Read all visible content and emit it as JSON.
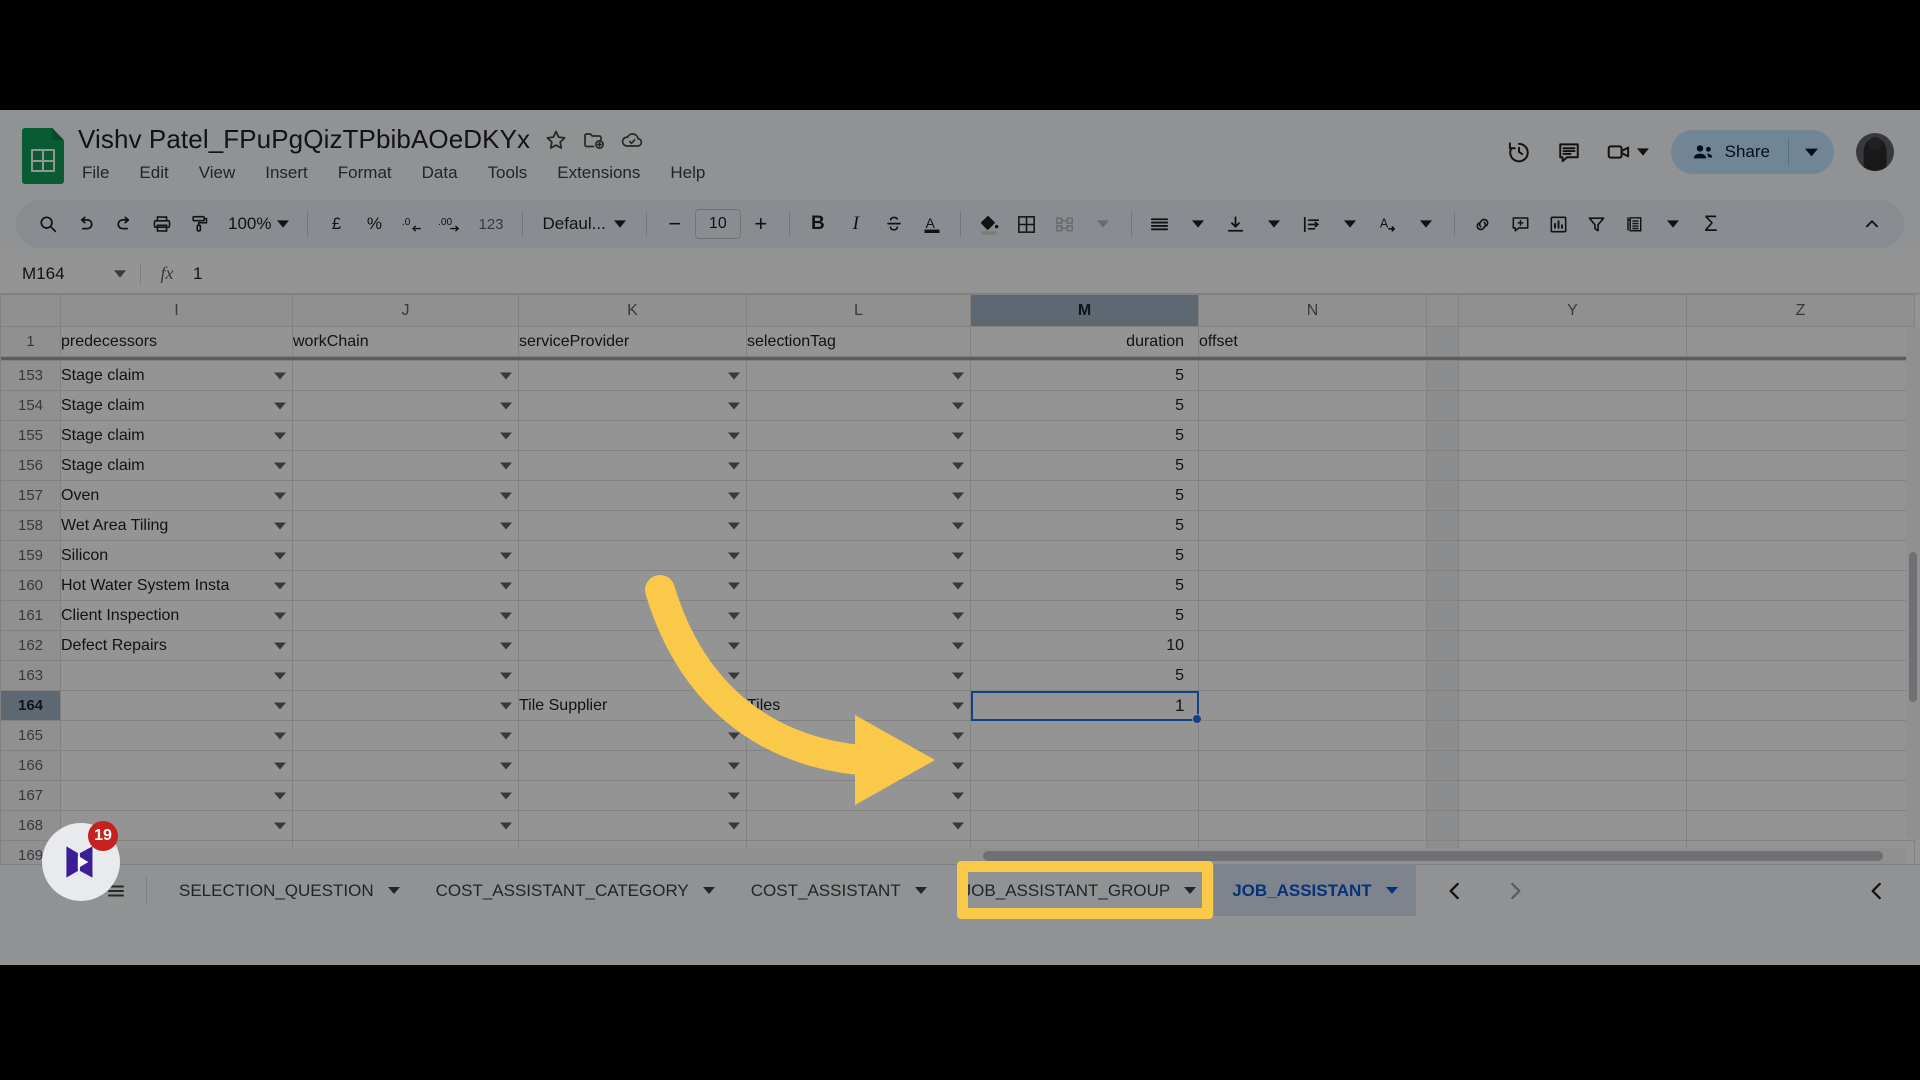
{
  "header": {
    "doc_title": "Vishv Patel_FPuPgQizTPbibAOeDKYx",
    "star_icon": "star-icon",
    "move_icon": "move-to-folder-icon",
    "cloud_icon": "cloud-saved-icon",
    "menu": [
      "File",
      "Edit",
      "View",
      "Insert",
      "Format",
      "Data",
      "Tools",
      "Extensions",
      "Help"
    ],
    "history_icon": "version-history-icon",
    "comment_icon": "comment-icon",
    "meet_icon": "video-camera-icon",
    "share_label": "Share",
    "share_people_icon": "people-icon",
    "share_caret_icon": "chevron-down-icon",
    "avatar": "user-avatar"
  },
  "toolbar": {
    "search_icon": "search-icon",
    "undo_icon": "undo-icon",
    "redo_icon": "redo-icon",
    "print_icon": "print-icon",
    "paint_format_icon": "paint-format-icon",
    "zoom_value": "100%",
    "currency_label": "£",
    "percent_label": "%",
    "decrease_decimal_label": ".0",
    "increase_decimal_label": ".00",
    "more_formats_label": "123",
    "font_name": "Defaul...",
    "font_decrease": "−",
    "font_size": "10",
    "font_increase": "+",
    "bold_label": "B",
    "italic_label": "I",
    "strikethrough_label": "S",
    "text_color_label": "A",
    "fill_color_icon": "fill-color-icon",
    "borders_icon": "borders-icon",
    "merge_cells_icon": "merge-cells-icon",
    "horizontal_align_icon": "horizontal-align-icon",
    "vertical_align_icon": "vertical-align-icon",
    "text_wrap_icon": "text-wrapping-icon",
    "text_rotation_icon": "text-rotation-icon",
    "link_icon": "insert-link-icon",
    "comment_add_icon": "insert-comment-icon",
    "chart_icon": "insert-chart-icon",
    "filter_icon": "create-filter-icon",
    "functions_icon": "functions-icon",
    "sigma_label": "Σ",
    "collapse_icon": "chevron-up-icon"
  },
  "formula_bar": {
    "name_box_value": "M164",
    "name_box_caret": "chevron-down-icon",
    "fx_label": "fx",
    "formula_value": "1"
  },
  "grid": {
    "columns": [
      {
        "letter": "I",
        "active": false
      },
      {
        "letter": "J",
        "active": false
      },
      {
        "letter": "K",
        "active": false
      },
      {
        "letter": "L",
        "active": false
      },
      {
        "letter": "M",
        "active": true
      },
      {
        "letter": "N",
        "active": false
      },
      {
        "letter": "Y",
        "active": false
      },
      {
        "letter": "Z",
        "active": false
      }
    ],
    "header_row": {
      "number": "1",
      "cells": [
        "predecessors",
        "workChain",
        "serviceProvider",
        "selectionTag",
        "duration",
        "offset",
        "",
        ""
      ]
    },
    "rows": [
      {
        "number": "153",
        "active": false,
        "cells": [
          "Stage claim",
          "",
          "",
          "",
          "5",
          "",
          "",
          ""
        ]
      },
      {
        "number": "154",
        "active": false,
        "cells": [
          "Stage claim",
          "",
          "",
          "",
          "5",
          "",
          "",
          ""
        ]
      },
      {
        "number": "155",
        "active": false,
        "cells": [
          "Stage claim",
          "",
          "",
          "",
          "5",
          "",
          "",
          ""
        ]
      },
      {
        "number": "156",
        "active": false,
        "cells": [
          "Stage claim",
          "",
          "",
          "",
          "5",
          "",
          "",
          ""
        ]
      },
      {
        "number": "157",
        "active": false,
        "cells": [
          "Oven",
          "",
          "",
          "",
          "5",
          "",
          "",
          ""
        ]
      },
      {
        "number": "158",
        "active": false,
        "cells": [
          "Wet Area Tiling",
          "",
          "",
          "",
          "5",
          "",
          "",
          ""
        ]
      },
      {
        "number": "159",
        "active": false,
        "cells": [
          "Silicon",
          "",
          "",
          "",
          "5",
          "",
          "",
          ""
        ]
      },
      {
        "number": "160",
        "active": false,
        "cells": [
          "Hot Water System Insta",
          "",
          "",
          "",
          "5",
          "",
          "",
          ""
        ]
      },
      {
        "number": "161",
        "active": false,
        "cells": [
          "Client Inspection",
          "",
          "",
          "",
          "5",
          "",
          "",
          ""
        ]
      },
      {
        "number": "162",
        "active": false,
        "cells": [
          "Defect Repairs",
          "",
          "",
          "",
          "10",
          "",
          "",
          ""
        ]
      },
      {
        "number": "163",
        "active": false,
        "cells": [
          "",
          "",
          "",
          "",
          "5",
          "",
          "",
          ""
        ]
      },
      {
        "number": "164",
        "active": true,
        "cells": [
          "",
          "",
          "Tile Supplier",
          "Tiles",
          "",
          "",
          "",
          ""
        ]
      },
      {
        "number": "165",
        "active": false,
        "cells": [
          "",
          "",
          "",
          "",
          "",
          "",
          "",
          ""
        ]
      },
      {
        "number": "166",
        "active": false,
        "cells": [
          "",
          "",
          "",
          "",
          "",
          "",
          "",
          ""
        ]
      },
      {
        "number": "167",
        "active": false,
        "cells": [
          "",
          "",
          "",
          "",
          "",
          "",
          "",
          ""
        ]
      },
      {
        "number": "168",
        "active": false,
        "cells": [
          "",
          "",
          "",
          "",
          "",
          "",
          "",
          ""
        ]
      },
      {
        "number": "169",
        "active": false,
        "cells": [
          "",
          "",
          "",
          "",
          "",
          "",
          "",
          ""
        ]
      }
    ],
    "selected_cell": {
      "ref": "M164",
      "value": "1"
    }
  },
  "tabbar": {
    "add_sheet_icon": "add-sheet-icon",
    "all_sheets_icon": "all-sheets-icon",
    "tabs": [
      {
        "label": "SELECTION_QUESTION",
        "active": false
      },
      {
        "label": "COST_ASSISTANT_CATEGORY",
        "active": false
      },
      {
        "label": "COST_ASSISTANT",
        "active": false
      },
      {
        "label": "JOB_ASSISTANT_GROUP",
        "active": false
      },
      {
        "label": "JOB_ASSISTANT",
        "active": true
      }
    ],
    "prev_icon": "chevron-left-icon",
    "next_icon": "chevron-right-icon",
    "sidebar_toggle_icon": "chevron-left-icon"
  },
  "overlay": {
    "arrow": "yellow-curved-arrow",
    "highlight_color": "#fbc94a",
    "app_badge_count": "19",
    "app_badge_name": "outlook-app-icon"
  }
}
